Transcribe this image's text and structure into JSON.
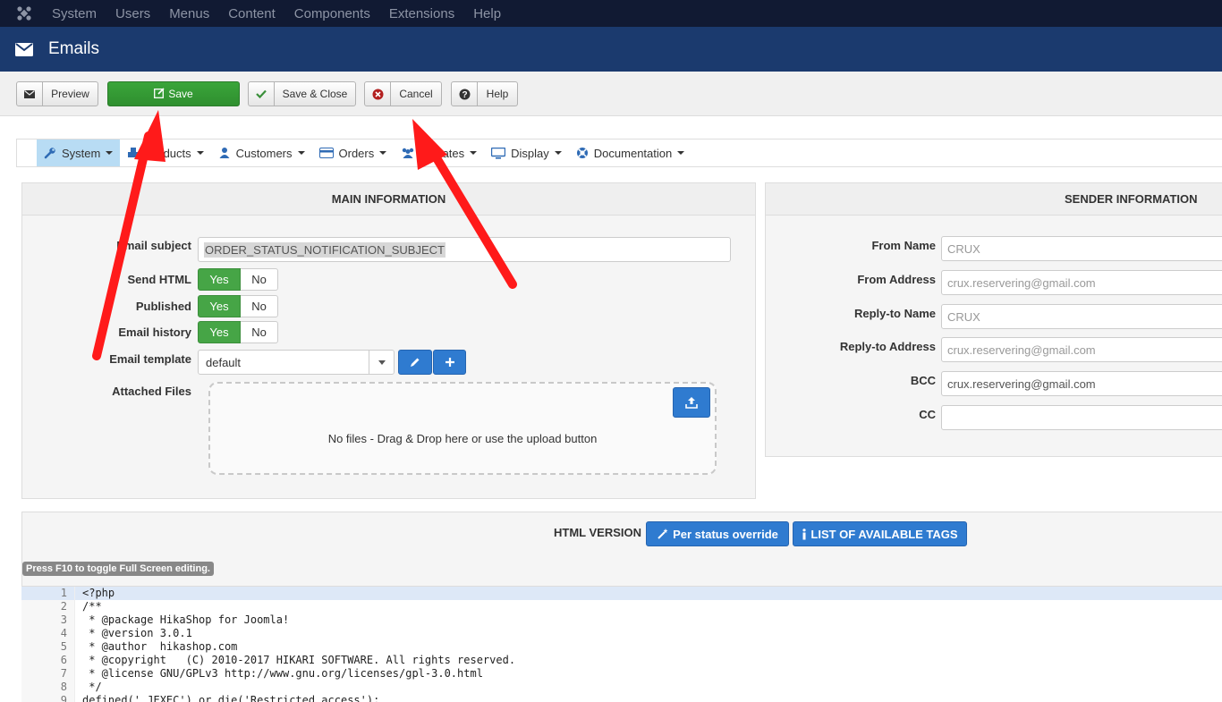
{
  "topbar": {
    "items": [
      "System",
      "Users",
      "Menus",
      "Content",
      "Components",
      "Extensions",
      "Help"
    ]
  },
  "titlebar": {
    "title": "Emails"
  },
  "toolbar": {
    "preview": "Preview",
    "save": "Save",
    "save_close": "Save & Close",
    "cancel": "Cancel",
    "help": "Help"
  },
  "nav": {
    "items": [
      "System",
      "Products",
      "Customers",
      "Orders",
      "Affiliates",
      "Display",
      "Documentation"
    ]
  },
  "main_info": {
    "header": "MAIN INFORMATION",
    "email_subject_label": "Email subject",
    "email_subject_value": "ORDER_STATUS_NOTIFICATION_SUBJECT",
    "send_html_label": "Send HTML",
    "published_label": "Published",
    "email_history_label": "Email history",
    "yes": "Yes",
    "no": "No",
    "email_template_label": "Email template",
    "email_template_value": "default",
    "attached_files_label": "Attached Files",
    "dropzone_text": "No files - Drag & Drop here or use the upload button"
  },
  "sender_info": {
    "header": "SENDER INFORMATION",
    "from_name_label": "From Name",
    "from_name_value": "CRUX",
    "from_address_label": "From Address",
    "from_address_value": "crux.reservering@gmail.com",
    "reply_name_label": "Reply-to Name",
    "reply_name_value": "CRUX",
    "reply_address_label": "Reply-to Address",
    "reply_address_value": "crux.reservering@gmail.com",
    "bcc_label": "BCC",
    "bcc_value": "crux.reservering@gmail.com",
    "cc_label": "CC",
    "cc_value": ""
  },
  "html_version": {
    "title": "HTML VERSION",
    "per_status": "Per status override",
    "tags": "LIST OF AVAILABLE TAGS",
    "tip": "Press F10 to toggle Full Screen editing."
  },
  "code": {
    "lines": [
      {
        "n": "1",
        "t": "<?php"
      },
      {
        "n": "2",
        "t": "/**"
      },
      {
        "n": "3",
        "t": " * @package HikaShop for Joomla!"
      },
      {
        "n": "4",
        "t": " * @version 3.0.1"
      },
      {
        "n": "5",
        "t": " * @author  hikashop.com"
      },
      {
        "n": "6",
        "t": " * @copyright   (C) 2010-2017 HIKARI SOFTWARE. All rights reserved."
      },
      {
        "n": "7",
        "t": " * @license GNU/GPLv3 http://www.gnu.org/licenses/gpl-3.0.html"
      },
      {
        "n": "8",
        "t": " */"
      },
      {
        "n": "9",
        "t": "defined('_JEXEC') or die('Restricted access');"
      }
    ]
  },
  "colors": {
    "topbar": "#111a33",
    "titlebar": "#1b3a6e",
    "save_green": "#3aa53a",
    "primary_blue": "#2f7bd0",
    "annotation_red": "#ff1a1a"
  }
}
